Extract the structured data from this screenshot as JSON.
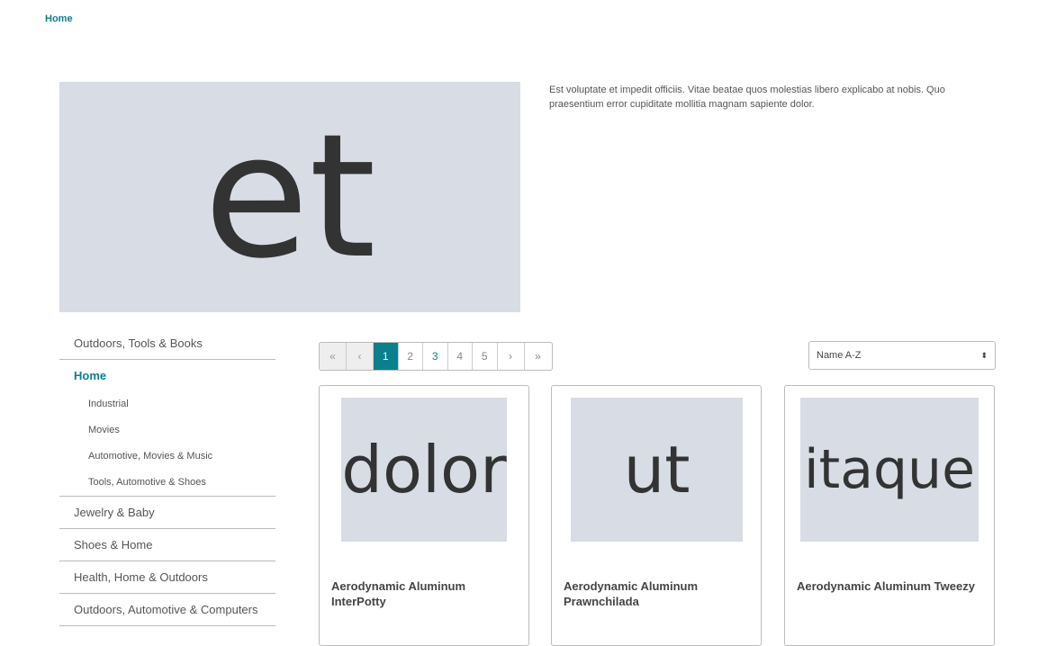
{
  "breadcrumb": {
    "home": "Home"
  },
  "category": {
    "image_text": "et",
    "description": "Est voluptate et impedit officiis. Vitae beatae quos molestias libero explicabo at nobis. Quo praesentium error cupiditate mollitia magnam sapiente dolor."
  },
  "sidebar": {
    "items": [
      {
        "label": "Outdoors, Tools & Books"
      },
      {
        "label": "Home",
        "active": true,
        "children": [
          "Industrial",
          "Movies",
          "Automotive, Movies & Music",
          "Tools, Automotive & Shoes"
        ]
      },
      {
        "label": "Jewelry & Baby"
      },
      {
        "label": "Shoes & Home"
      },
      {
        "label": "Health, Home & Outdoors"
      },
      {
        "label": "Outdoors, Automotive & Computers"
      }
    ]
  },
  "pagination": {
    "first": "«",
    "prev": "‹",
    "pages": [
      "1",
      "2",
      "3",
      "4",
      "5"
    ],
    "current": "1",
    "next": "›",
    "last": "»"
  },
  "sort": {
    "selected": "Name A-Z",
    "arrow": "⬍"
  },
  "products": [
    {
      "image_text": "dolor",
      "name": "Aerodynamic Aluminum InterPotty"
    },
    {
      "image_text": "ut",
      "name": "Aerodynamic Aluminum Prawnchilada"
    },
    {
      "image_text": "itaque",
      "name": "Aerodynamic Aluminum Tweezy"
    }
  ],
  "colors": {
    "accent": "#0b7f8c",
    "placeholder": "#d8dce5"
  }
}
